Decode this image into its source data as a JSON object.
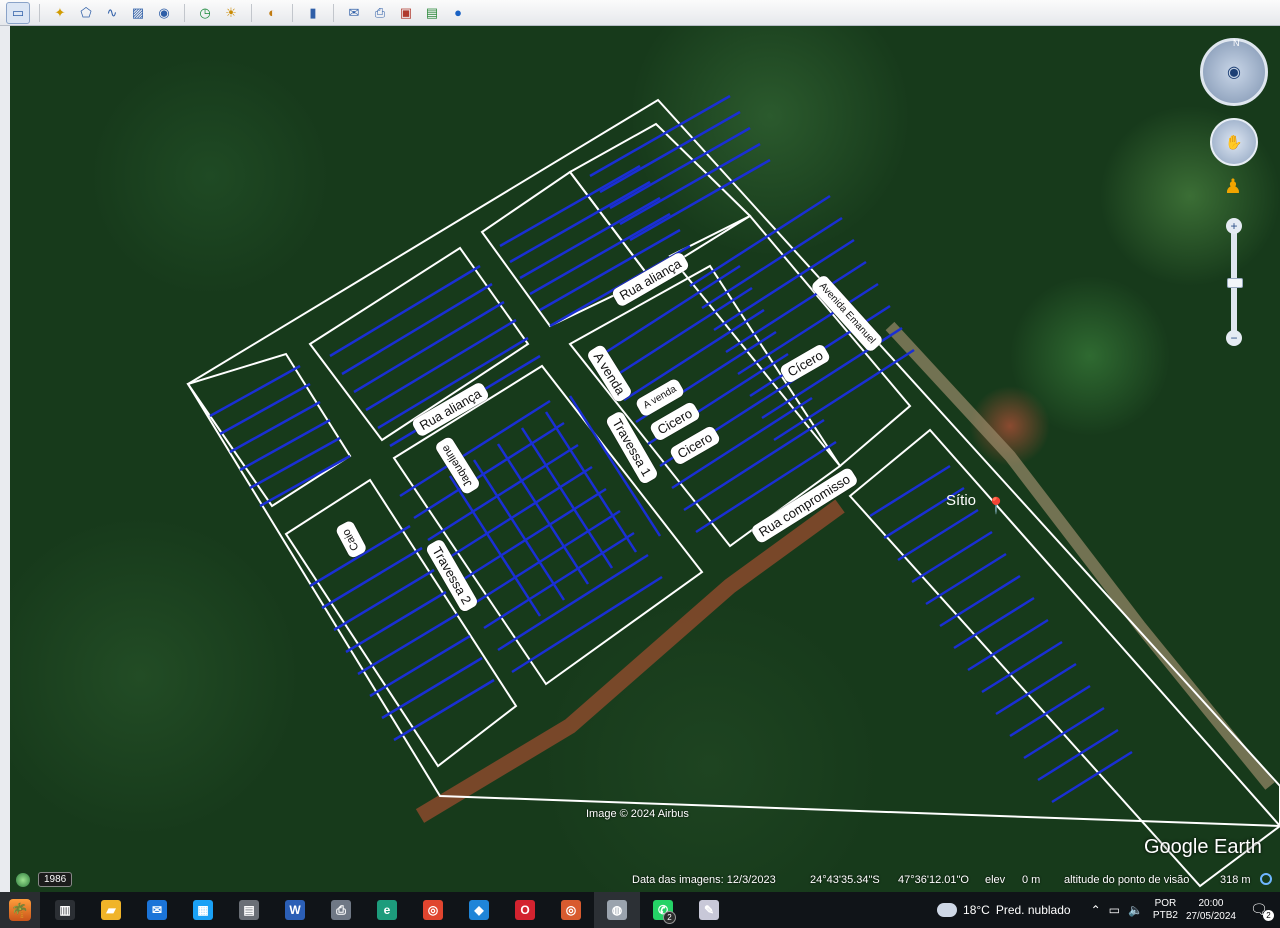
{
  "toolbar": {
    "icons": [
      "sidebar-toggle-icon",
      "add-placemark-icon",
      "add-polygon-icon",
      "add-path-icon",
      "add-image-overlay-icon",
      "record-tour-icon",
      "historical-imagery-icon",
      "sunlight-icon",
      "planets-icon",
      "ruler-icon",
      "email-icon",
      "print-icon",
      "save-image-icon",
      "view-in-maps-icon",
      "earth-icon"
    ]
  },
  "map": {
    "labels": {
      "rua_alianca_1": "Rua aliança",
      "rua_alianca_2": "Rua aliança",
      "avenida_emanuel": "Avenida Emanuel",
      "a_venda_1": "A venda",
      "a_venda_2": "A venda",
      "cicero_1": "Cicero",
      "cicero_2": "Cicero",
      "cicero_3": "Cícero",
      "travessa_1": "Travessa 1",
      "travessa_2": "Travessa 2",
      "jaqueline": "Jaqueline",
      "caio": "Caio",
      "rua_compromisso": "Rua compromisso"
    },
    "placemark": "Sítio",
    "credit": "Image © 2024 Airbus",
    "logo": "Google Earth"
  },
  "status": {
    "year_badge": "1986",
    "imagery_date": "Data das imagens: 12/3/2023",
    "lat": "24°43'35.34\"S",
    "lon": "47°36'12.01\"O",
    "elev_label": "elev",
    "elev_value": "0 m",
    "eye_alt_label": "altitude do ponto de visão",
    "eye_alt_value": "318 m"
  },
  "navigation": {
    "north": "N",
    "zoom_plus": "+",
    "zoom_minus": "−"
  },
  "taskbar": {
    "apps": [
      {
        "name": "task-view-icon",
        "glyph": "▥",
        "color": "#2b2f34"
      },
      {
        "name": "file-explorer-icon",
        "glyph": "▰",
        "color": "#f0b429"
      },
      {
        "name": "mail-icon",
        "glyph": "✉",
        "color": "#1b74d8"
      },
      {
        "name": "store-icon",
        "glyph": "▦",
        "color": "#1aa1f5"
      },
      {
        "name": "calculator-icon",
        "glyph": "▤",
        "color": "#6a6f76"
      },
      {
        "name": "word-icon",
        "glyph": "W",
        "color": "#2b5fb6"
      },
      {
        "name": "printer-icon",
        "glyph": "⎙",
        "color": "#6f7885"
      },
      {
        "name": "edge-icon",
        "glyph": "e",
        "color": "#1d9c7c"
      },
      {
        "name": "chrome-icon",
        "glyph": "◎",
        "color": "#e0452f"
      },
      {
        "name": "vscode-icon",
        "glyph": "◆",
        "color": "#1f85d8"
      },
      {
        "name": "opera-icon",
        "glyph": "O",
        "color": "#d3232f"
      },
      {
        "name": "chrome-profile-icon",
        "glyph": "◎",
        "color": "#d85b2f"
      },
      {
        "name": "google-earth-icon",
        "glyph": "◍",
        "color": "#9aa3ad",
        "active": true
      },
      {
        "name": "whatsapp-icon",
        "glyph": "✆",
        "color": "#25d366",
        "badge": "2"
      },
      {
        "name": "paint-icon",
        "glyph": "✎",
        "color": "#c8c8d8"
      }
    ],
    "weather_temp": "18°C",
    "weather_desc": "Pred. nublado",
    "lang_top": "POR",
    "lang_bottom": "PTB2",
    "time": "20:00",
    "date": "27/05/2024",
    "notif_count": "2"
  }
}
